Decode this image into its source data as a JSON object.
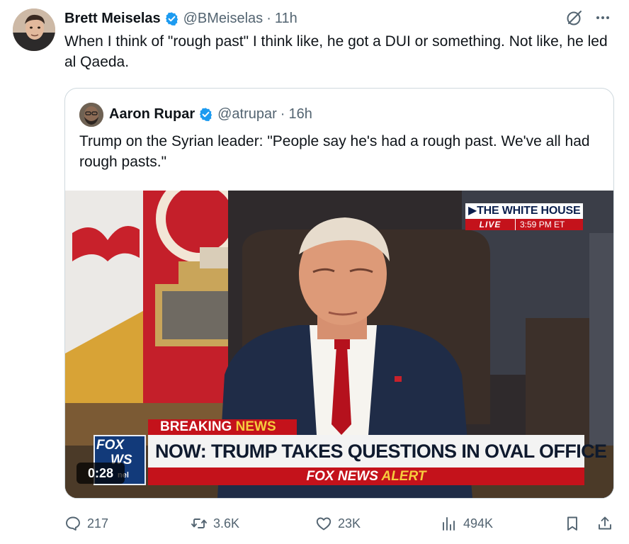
{
  "tweet": {
    "author_name": "Brett Meiselas",
    "author_handle": "@BMeiselas",
    "separator": "·",
    "time": "11h",
    "text": "When I think of \"rough past\" I think like, he got a DUI or something. Not like, he led al Qaeda."
  },
  "quote": {
    "author_name": "Aaron Rupar",
    "author_handle": "@atrupar",
    "separator": "·",
    "time": "16h",
    "text": "Trump on the Syrian leader: \"People say he's had a rough past. We've all had rough pasts.\""
  },
  "video": {
    "bug_title": "▶THE WHITE HOUSE",
    "bug_live": "LIVE",
    "bug_time": "3:59 PM ET",
    "breaking_word1": "BREAKING",
    "breaking_word2": "NEWS",
    "headline": "NOW: TRUMP TAKES QUESTIONS IN OVAL OFFICE",
    "alert_brand": "FOX NEWS",
    "alert_word": "ALERT",
    "logo_line1": "FOX",
    "logo_line2": "WS",
    "logo_line3": "nel",
    "duration": "0:28"
  },
  "actions": {
    "replies": "217",
    "reposts": "3.6K",
    "likes": "23K",
    "views": "494K"
  },
  "icons": {
    "verified": "verified-badge-icon",
    "grok": "grok-icon",
    "more": "more-icon",
    "reply": "reply-icon",
    "repost": "repost-icon",
    "like": "like-icon",
    "views": "views-icon",
    "bookmark": "bookmark-icon",
    "share": "share-icon"
  },
  "colors": {
    "verified": "#1d9bf0",
    "secondary_text": "#536471",
    "fox_red": "#c4121b",
    "fox_blue": "#123a7a",
    "fox_yellow": "#f6cc3d"
  }
}
